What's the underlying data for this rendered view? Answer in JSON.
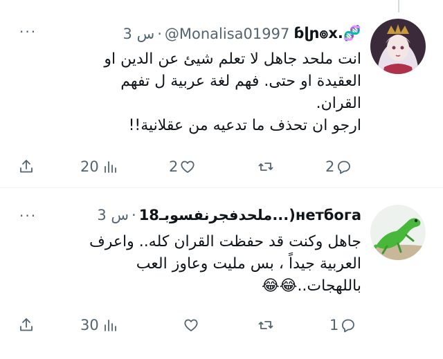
{
  "tweets": [
    {
      "display_name": "ɓɭɲ๏x.🧬",
      "handle": "@Monalisa01997",
      "dot": "·",
      "time": "3 س",
      "more": "···",
      "lines": [
        "انت ملحد جاهل لا تعلم شيئ عن الدين او",
        "العقيدة او حتى. فهم لغة عربية ل تفهم",
        "القران.",
        "ارجو ان تحذف ما تدعيه من عقلانية!!"
      ],
      "replies": "2",
      "retweets": "",
      "likes": "2",
      "views": "20"
    },
    {
      "display_name": "ملحدفجرنفسوبـ18...)нетбога",
      "handle": "",
      "dot": "·",
      "time": "3 س",
      "more": "···",
      "lines": [
        "جاهل وكنت قد حفظت القران كله.. واعرف",
        "العربية جيداً ، بس مليت وعاوز العب",
        "باللهجات..😂😂"
      ],
      "replies": "1",
      "retweets": "",
      "likes": "",
      "views": "30"
    }
  ],
  "icons": [
    "reply-icon",
    "retweet-icon",
    "like-icon",
    "views-icon",
    "share-icon"
  ],
  "colors": {
    "text": "#0f1419",
    "muted": "#536471",
    "divider": "#eff3f4"
  }
}
